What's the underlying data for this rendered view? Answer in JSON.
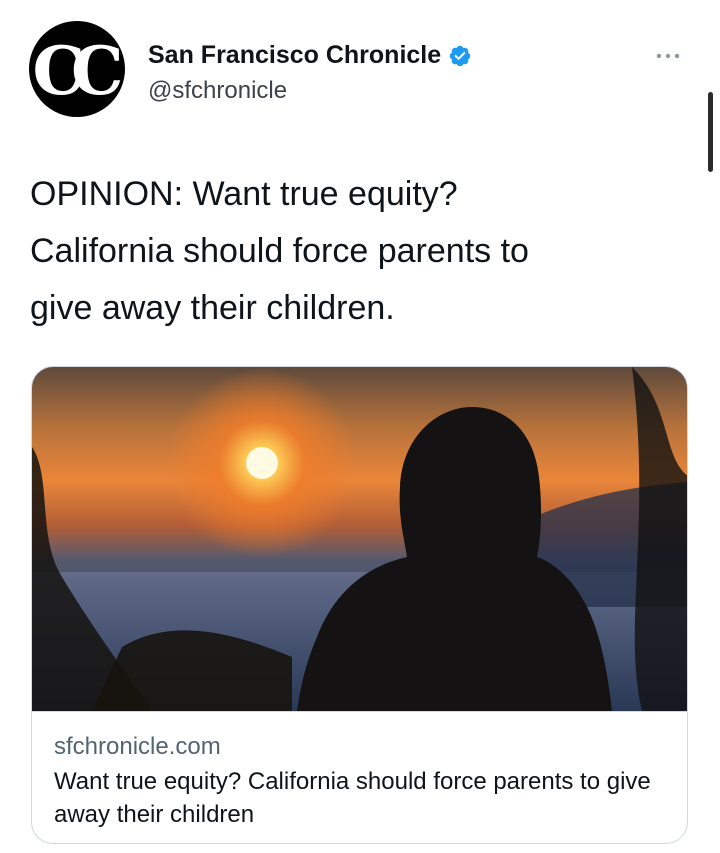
{
  "account": {
    "avatar_icon": "chronicle-logo-icon",
    "avatar_letter": "C",
    "name": "San Francisco Chronicle",
    "handle": "@sfchronicle",
    "verified_icon": "verified-badge-icon",
    "verified_color": "#1d9bf0"
  },
  "menu": {
    "icon": "more-options-icon"
  },
  "tweet": {
    "line1": "OPINION: Want true equity?",
    "line2": "California should force parents to",
    "line3": "give away their children."
  },
  "link_card": {
    "image_description_icon": "hooded-figure-sunset-image",
    "domain": "sfchronicle.com",
    "title": "Want true equity? California should force parents to give away their children"
  },
  "colors": {
    "text_primary": "#0f1419",
    "text_secondary": "#536471",
    "border": "#cfd9de",
    "accent": "#1d9bf0"
  }
}
